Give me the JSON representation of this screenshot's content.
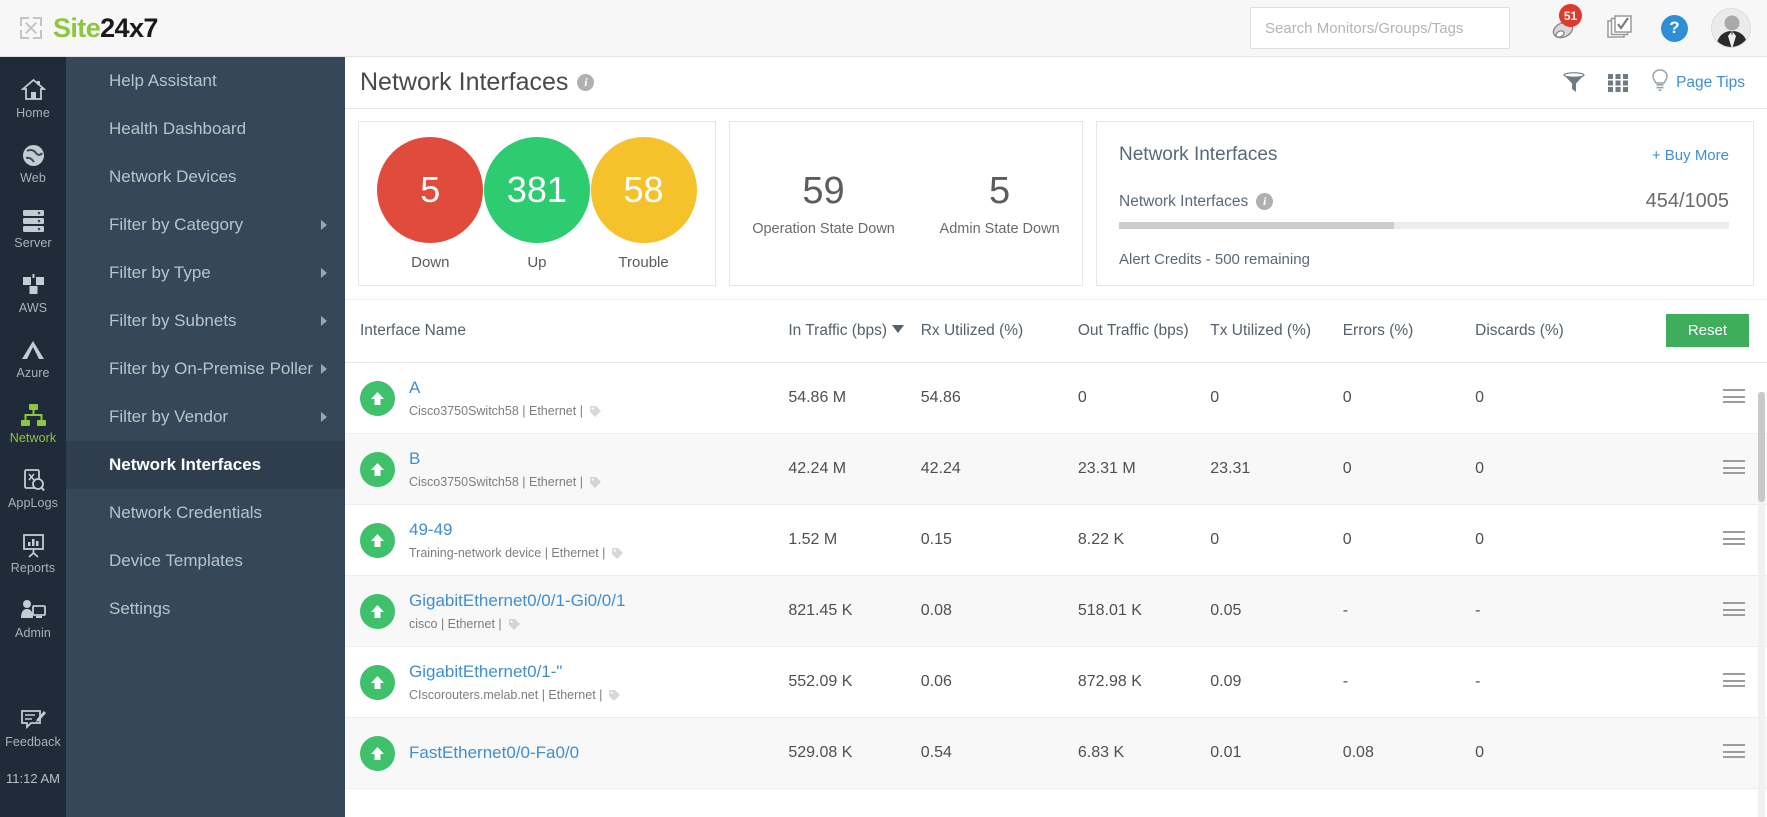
{
  "brand": {
    "site": "Site",
    "num": "24x7"
  },
  "topbar": {
    "search_placeholder": "Search Monitors/Groups/Tags",
    "search_value": "",
    "alert_badge": "51",
    "bell_icon": "bell-icon",
    "tasks_icon": "checklist-icon",
    "help_icon": "help-icon",
    "help_label": "?",
    "avatar_icon": "avatar-icon"
  },
  "rail": {
    "items": [
      {
        "label": "Home",
        "icon": "home-icon",
        "active": false
      },
      {
        "label": "Web",
        "icon": "globe-icon",
        "active": false
      },
      {
        "label": "Server",
        "icon": "server-icon",
        "active": false
      },
      {
        "label": "AWS",
        "icon": "aws-icon",
        "active": false
      },
      {
        "label": "Azure",
        "icon": "azure-icon",
        "active": false
      },
      {
        "label": "Network",
        "icon": "network-icon",
        "active": true
      },
      {
        "label": "AppLogs",
        "icon": "applogs-icon",
        "active": false
      },
      {
        "label": "Reports",
        "icon": "reports-icon",
        "active": false
      },
      {
        "label": "Admin",
        "icon": "admin-icon",
        "active": false
      },
      {
        "label": "Feedback",
        "icon": "feedback-icon",
        "active": false
      }
    ],
    "time": "11:12 AM"
  },
  "submenu": {
    "items": [
      {
        "label": "Help Assistant",
        "active": false,
        "caret": false
      },
      {
        "label": "Health Dashboard",
        "active": false,
        "caret": false
      },
      {
        "label": "Network Devices",
        "active": false,
        "caret": false
      },
      {
        "label": "Filter by Category",
        "active": false,
        "caret": true
      },
      {
        "label": "Filter by Type",
        "active": false,
        "caret": true
      },
      {
        "label": "Filter by Subnets",
        "active": false,
        "caret": true
      },
      {
        "label": "Filter by On-Premise Poller",
        "active": false,
        "caret": true
      },
      {
        "label": "Filter by Vendor",
        "active": false,
        "caret": true
      },
      {
        "label": "Network Interfaces",
        "active": true,
        "caret": false
      },
      {
        "label": "Network Credentials",
        "active": false,
        "caret": false
      },
      {
        "label": "Device Templates",
        "active": false,
        "caret": false
      },
      {
        "label": "Settings",
        "active": false,
        "caret": false
      }
    ]
  },
  "page": {
    "title": "Network Interfaces",
    "info_icon": "info-icon",
    "filter_icon": "filter-icon",
    "grid_icon": "grid-icon",
    "tips_icon": "bulb-icon",
    "tips_label": "Page Tips"
  },
  "summary": {
    "donuts": [
      {
        "value": "5",
        "label": "Down",
        "color": "#e04b3c"
      },
      {
        "value": "381",
        "label": "Up",
        "color": "#2ecc71"
      },
      {
        "value": "58",
        "label": "Trouble",
        "color": "#f5c22b"
      }
    ],
    "states": [
      {
        "value": "59",
        "label": "Operation State Down"
      },
      {
        "value": "5",
        "label": "Admin State Down"
      }
    ],
    "credits": {
      "title": "Network Interfaces",
      "buy_more": "+ Buy More",
      "sub_label": "Network Interfaces",
      "info_icon": "info-icon",
      "count": "454/1005",
      "bar_percent": 45,
      "note": "Alert Credits - 500 remaining"
    }
  },
  "table": {
    "columns": [
      {
        "key": "name",
        "label": "Interface Name",
        "sorted": false
      },
      {
        "key": "in",
        "label": "In Traffic (bps)",
        "sorted": true
      },
      {
        "key": "rx",
        "label": "Rx Utilized (%)",
        "sorted": false
      },
      {
        "key": "out",
        "label": "Out Traffic (bps)",
        "sorted": false
      },
      {
        "key": "tx",
        "label": "Tx Utilized (%)",
        "sorted": false
      },
      {
        "key": "err",
        "label": "Errors (%)",
        "sorted": false
      },
      {
        "key": "dis",
        "label": "Discards (%)",
        "sorted": false
      }
    ],
    "reset_label": "Reset",
    "rows": [
      {
        "status": "up",
        "name": "A",
        "sub": "Cisco3750Switch58 | Ethernet |",
        "in": "54.86 M",
        "rx": "54.86",
        "out": "0",
        "tx": "0",
        "err": "0",
        "dis": "0"
      },
      {
        "status": "up",
        "name": "B",
        "sub": "Cisco3750Switch58 | Ethernet |",
        "in": "42.24 M",
        "rx": "42.24",
        "out": "23.31 M",
        "tx": "23.31",
        "err": "0",
        "dis": "0"
      },
      {
        "status": "up",
        "name": "49-49",
        "sub": "Training-network device | Ethernet |",
        "in": "1.52 M",
        "rx": "0.15",
        "out": "8.22 K",
        "tx": "0",
        "err": "0",
        "dis": "0"
      },
      {
        "status": "up",
        "name": "GigabitEthernet0/0/1-Gi0/0/1",
        "sub": "cisco | Ethernet |",
        "in": "821.45 K",
        "rx": "0.08",
        "out": "518.01 K",
        "tx": "0.05",
        "err": "-",
        "dis": "-"
      },
      {
        "status": "up",
        "name": "GigabitEthernet0/1-\"",
        "sub": "CIscorouters.melab.net | Ethernet |",
        "in": "552.09 K",
        "rx": "0.06",
        "out": "872.98 K",
        "tx": "0.09",
        "err": "-",
        "dis": "-"
      },
      {
        "status": "up",
        "name": "FastEthernet0/0-Fa0/0",
        "sub": "",
        "in": "529.08 K",
        "rx": "0.54",
        "out": "6.83 K",
        "tx": "0.01",
        "err": "0.08",
        "dis": "0"
      }
    ]
  }
}
